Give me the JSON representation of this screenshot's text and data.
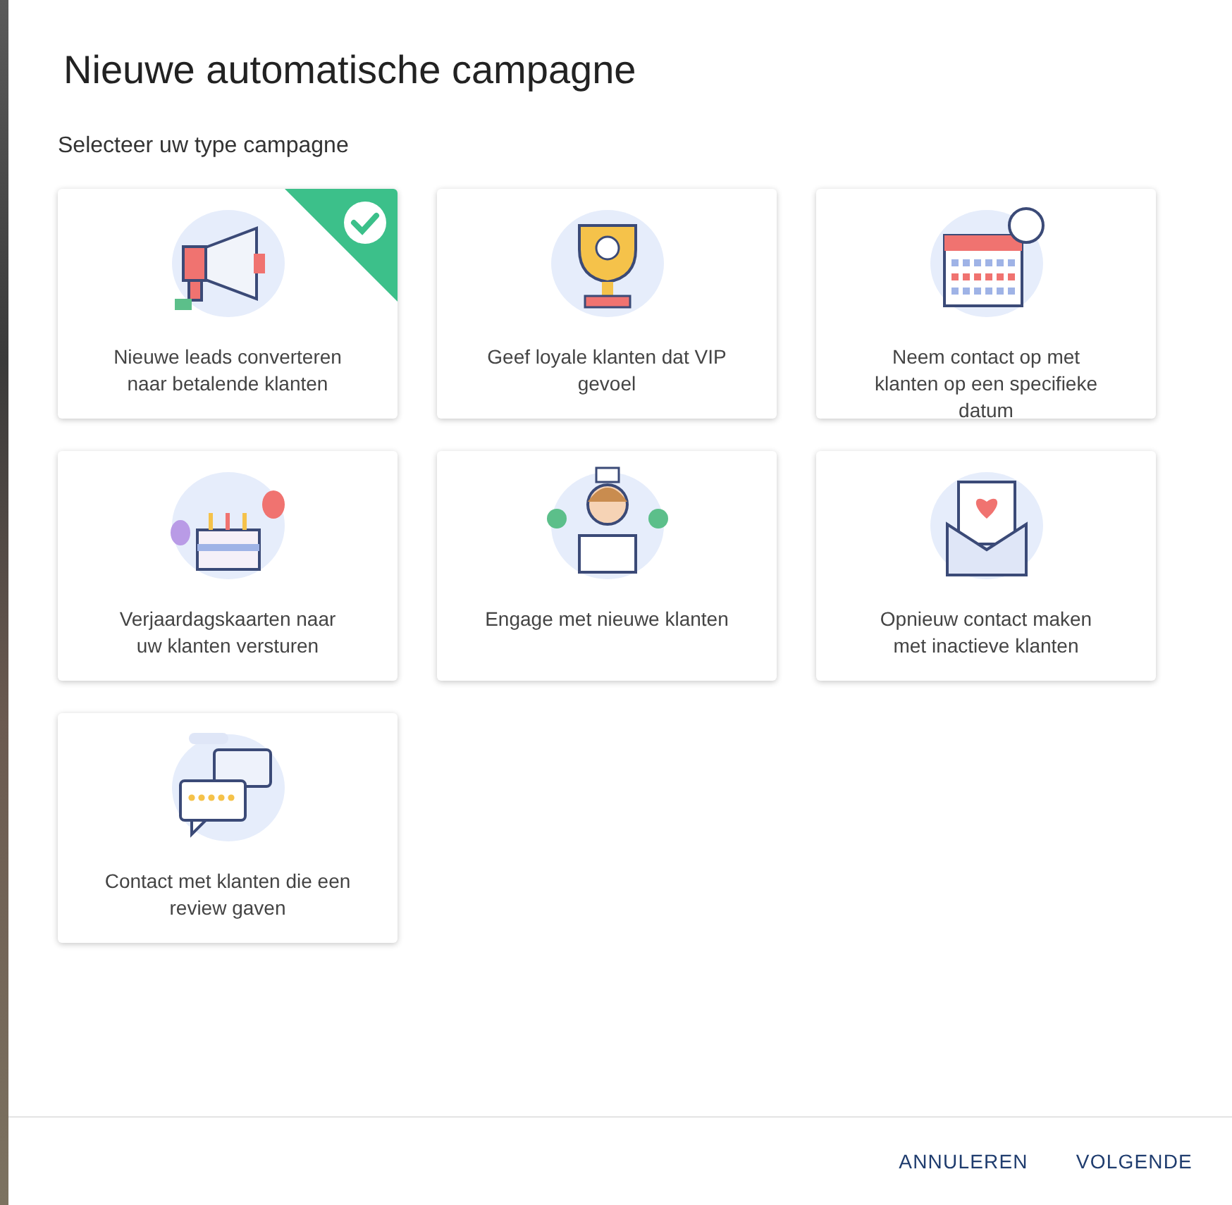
{
  "dialog": {
    "title": "Nieuwe automatische campagne",
    "subtitle": "Selecteer uw type campagne"
  },
  "cards": [
    {
      "label": "Nieuwe leads converteren naar betalende klanten",
      "selected": true
    },
    {
      "label": "Geef loyale klanten dat VIP gevoel",
      "selected": false
    },
    {
      "label": "Neem contact op met klanten op een specifieke datum",
      "selected": false
    },
    {
      "label": "Verjaardagskaarten naar uw klanten versturen",
      "selected": false
    },
    {
      "label": "Engage met nieuwe klanten",
      "selected": false
    },
    {
      "label": "Opnieuw contact maken met inactieve klanten",
      "selected": false
    },
    {
      "label": "Contact met klanten die een review gaven",
      "selected": false
    }
  ],
  "buttons": [
    "ANNULEREN",
    "VOLGENDE"
  ]
}
